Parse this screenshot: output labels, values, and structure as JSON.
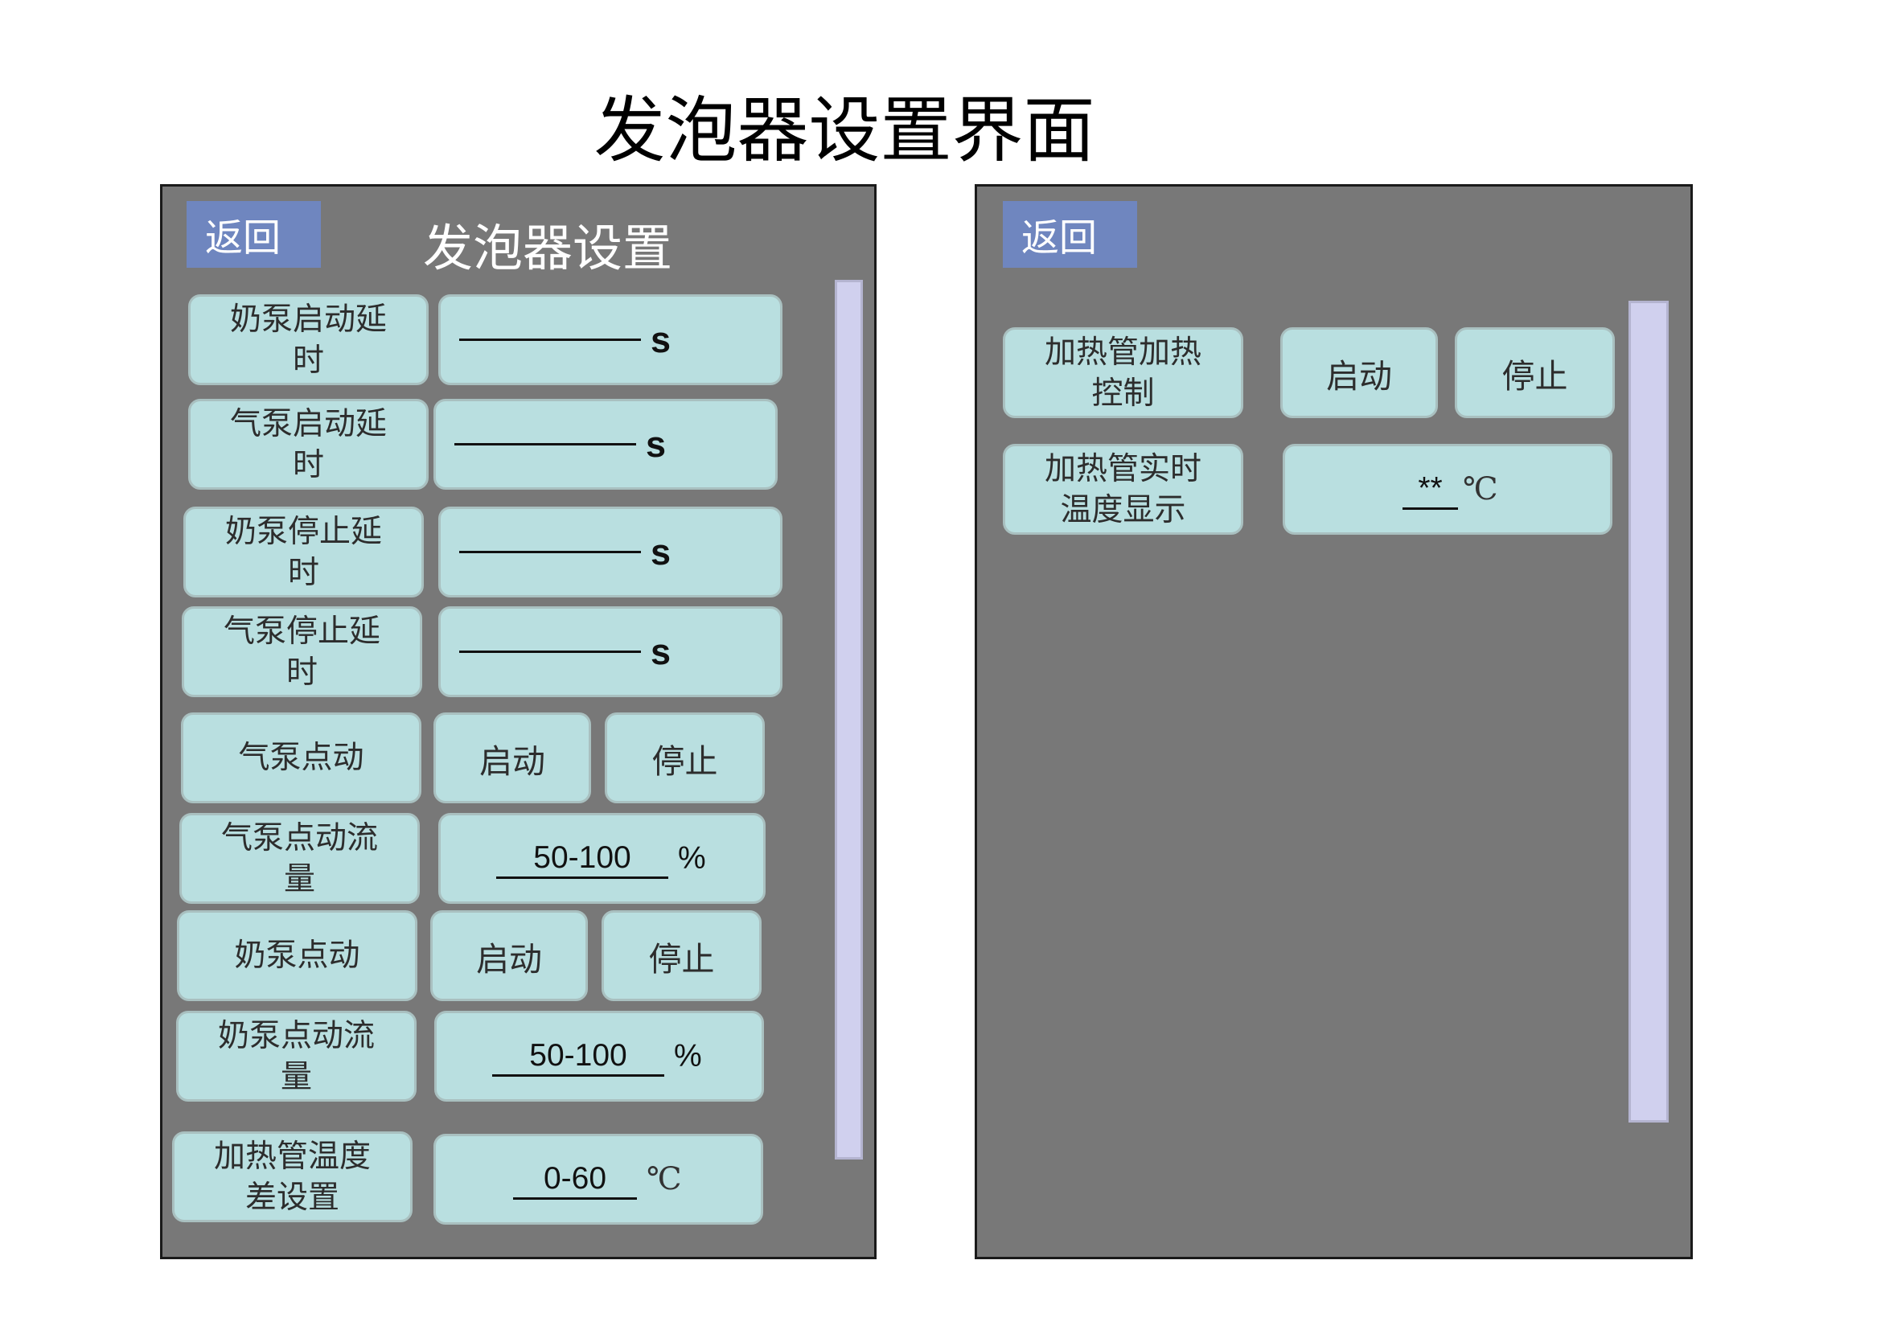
{
  "page_title": "发泡器设置界面",
  "left_panel": {
    "back_label": "返回",
    "title": "发泡器设置",
    "milk_pump_start_delay": {
      "label": "奶泵启动延\n时",
      "value": "",
      "unit": "s"
    },
    "air_pump_start_delay": {
      "label": "气泵启动延\n时",
      "value": "",
      "unit": "s"
    },
    "milk_pump_stop_delay": {
      "label": "奶泵停止延\n时",
      "value": "",
      "unit": "s"
    },
    "air_pump_stop_delay": {
      "label": "气泵停止延\n时",
      "value": "",
      "unit": "s"
    },
    "air_pump_jog": {
      "label": "气泵点动",
      "start_label": "启动",
      "stop_label": "停止"
    },
    "air_pump_jog_flow": {
      "label": "气泵点动流\n量",
      "value": "50-100",
      "unit": "%"
    },
    "milk_pump_jog": {
      "label": "奶泵点动",
      "start_label": "启动",
      "stop_label": "停止"
    },
    "milk_pump_jog_flow": {
      "label": "奶泵点动流\n量",
      "value": "50-100",
      "unit": "%"
    },
    "heater_temp_diff": {
      "label": "加热管温度\n差设置",
      "value": "0-60",
      "unit": "℃"
    }
  },
  "right_panel": {
    "back_label": "返回",
    "heater_control": {
      "label": "加热管加热\n控制",
      "start_label": "启动",
      "stop_label": "停止"
    },
    "heater_realtime_temp": {
      "label": "加热管实时\n温度显示",
      "value": "**",
      "unit": "℃"
    }
  },
  "colors": {
    "panel_bg": "#787878",
    "box_bg": "#b9dfe0",
    "back_button": "#6f86bf",
    "scrollbar": "#d0d0ee"
  }
}
